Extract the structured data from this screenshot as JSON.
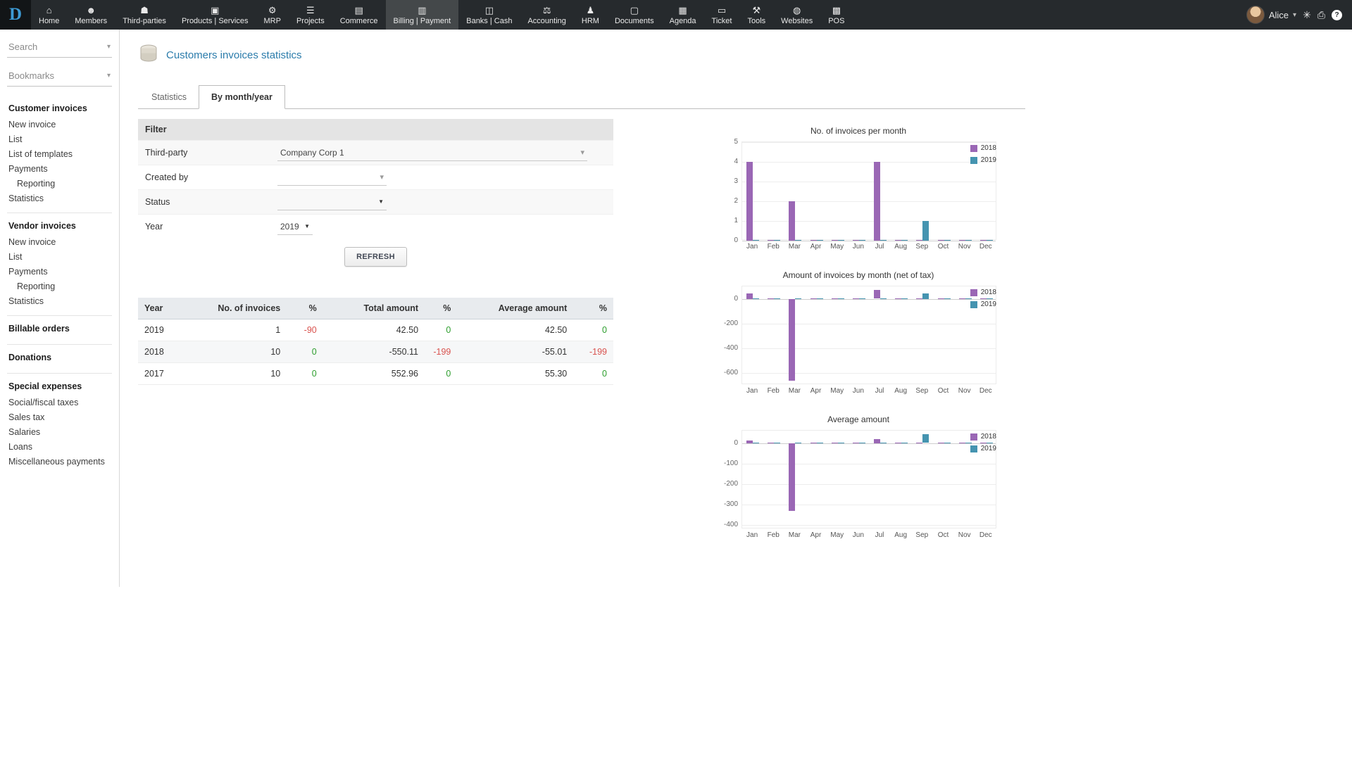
{
  "colors": {
    "positive": "#2e9e2e",
    "negative": "#d9534f",
    "accent": "#2b7cab"
  },
  "icons": {
    "chevron_down": "▾",
    "select_caret": "▼",
    "bug": "✳",
    "print": "⎙",
    "help": "?"
  },
  "topbar": {
    "logo": "D",
    "active_item": "Billing | Payment",
    "items": [
      {
        "label": "Home",
        "icon": "home-icon",
        "glyph": "⌂"
      },
      {
        "label": "Members",
        "icon": "members-icon",
        "glyph": "☻"
      },
      {
        "label": "Third-parties",
        "icon": "third-parties-icon",
        "glyph": "☗"
      },
      {
        "label": "Products | Services",
        "icon": "products-services-icon",
        "glyph": "▣"
      },
      {
        "label": "MRP",
        "icon": "mrp-icon",
        "glyph": "⚙"
      },
      {
        "label": "Projects",
        "icon": "projects-icon",
        "glyph": "☰"
      },
      {
        "label": "Commerce",
        "icon": "commerce-icon",
        "glyph": "▤"
      },
      {
        "label": "Billing | Payment",
        "icon": "billing-payment-icon",
        "glyph": "▥"
      },
      {
        "label": "Banks | Cash",
        "icon": "banks-cash-icon",
        "glyph": "◫"
      },
      {
        "label": "Accounting",
        "icon": "accounting-icon",
        "glyph": "⚖"
      },
      {
        "label": "HRM",
        "icon": "hrm-icon",
        "glyph": "♟"
      },
      {
        "label": "Documents",
        "icon": "documents-icon",
        "glyph": "▢"
      },
      {
        "label": "Agenda",
        "icon": "agenda-icon",
        "glyph": "▦"
      },
      {
        "label": "Ticket",
        "icon": "ticket-icon",
        "glyph": "▭"
      },
      {
        "label": "Tools",
        "icon": "tools-icon",
        "glyph": "⚒"
      },
      {
        "label": "Websites",
        "icon": "websites-icon",
        "glyph": "◍"
      },
      {
        "label": "POS",
        "icon": "pos-icon",
        "glyph": "▩"
      }
    ],
    "user": {
      "name": "Alice"
    }
  },
  "sidebar": {
    "search_label": "Search",
    "bookmarks_label": "Bookmarks",
    "sections": [
      {
        "title": "Customer invoices",
        "items": [
          {
            "label": "New invoice"
          },
          {
            "label": "List"
          },
          {
            "label": "List of templates"
          },
          {
            "label": "Payments"
          },
          {
            "label": "Reporting",
            "indent": true
          },
          {
            "label": "Statistics"
          }
        ]
      },
      {
        "title": "Vendor invoices",
        "items": [
          {
            "label": "New invoice"
          },
          {
            "label": "List"
          },
          {
            "label": "Payments"
          },
          {
            "label": "Reporting",
            "indent": true
          },
          {
            "label": "Statistics"
          }
        ]
      },
      {
        "title": "Billable orders",
        "items": []
      },
      {
        "title": "Donations",
        "items": []
      },
      {
        "title": "Special expenses",
        "items": [
          {
            "label": "Social/fiscal taxes"
          },
          {
            "label": "Sales tax"
          },
          {
            "label": "Salaries"
          },
          {
            "label": "Loans"
          },
          {
            "label": "Miscellaneous payments"
          }
        ]
      }
    ]
  },
  "page": {
    "title": "Customers invoices statistics"
  },
  "tabs": [
    {
      "label": "Statistics",
      "active": false
    },
    {
      "label": "By month/year",
      "active": true
    }
  ],
  "filter": {
    "header": "Filter",
    "third_party": {
      "label": "Third-party",
      "value": "Company Corp 1"
    },
    "created_by": {
      "label": "Created by",
      "value": ""
    },
    "status": {
      "label": "Status",
      "value": ""
    },
    "year": {
      "label": "Year",
      "value": "2019"
    },
    "refresh_label": "REFRESH"
  },
  "table": {
    "headers": [
      "Year",
      "No. of invoices",
      "%",
      "Total amount",
      "%",
      "Average amount",
      "%"
    ],
    "percent_columns": [
      2,
      4,
      6
    ],
    "rows": [
      {
        "cells": [
          "2019",
          "1",
          "-90",
          "42.50",
          "0",
          "42.50",
          "0"
        ]
      },
      {
        "cells": [
          "2018",
          "10",
          "0",
          "-550.11",
          "-199",
          "-55.01",
          "-199"
        ]
      },
      {
        "cells": [
          "2017",
          "10",
          "0",
          "552.96",
          "0",
          "55.30",
          "0"
        ]
      }
    ]
  },
  "chart_data": [
    {
      "type": "bar",
      "title": "No. of invoices per month",
      "categories": [
        "Jan",
        "Feb",
        "Mar",
        "Apr",
        "May",
        "Jun",
        "Jul",
        "Aug",
        "Sep",
        "Oct",
        "Nov",
        "Dec"
      ],
      "series": [
        {
          "name": "2018",
          "color": "#9a67b5",
          "values": [
            4,
            0,
            2,
            0,
            0,
            0,
            4,
            0,
            0,
            0,
            0,
            0
          ]
        },
        {
          "name": "2019",
          "color": "#4594b0",
          "values": [
            0,
            0,
            0,
            0,
            0,
            0,
            0,
            0,
            1,
            0,
            0,
            0
          ]
        }
      ],
      "ylim": [
        0,
        5
      ],
      "yticks": [
        0,
        1,
        2,
        3,
        4,
        5
      ],
      "legend": "top-right",
      "grid": true
    },
    {
      "type": "bar",
      "title": "Amount of invoices by month (net of tax)",
      "categories": [
        "Jan",
        "Feb",
        "Mar",
        "Apr",
        "May",
        "Jun",
        "Jul",
        "Aug",
        "Sep",
        "Oct",
        "Nov",
        "Dec"
      ],
      "series": [
        {
          "name": "2018",
          "color": "#9a67b5",
          "values": [
            45,
            0,
            -664,
            0,
            0,
            0,
            69,
            0,
            0,
            0,
            0,
            0
          ]
        },
        {
          "name": "2019",
          "color": "#4594b0",
          "values": [
            0,
            0,
            0,
            0,
            0,
            0,
            0,
            0,
            42.5,
            0,
            0,
            0
          ]
        }
      ],
      "ylim": [
        -700,
        100
      ],
      "yticks": [
        0,
        -200,
        -400,
        -600
      ],
      "legend": "top-right",
      "grid": true
    },
    {
      "type": "bar",
      "title": "Average amount",
      "categories": [
        "Jan",
        "Feb",
        "Mar",
        "Apr",
        "May",
        "Jun",
        "Jul",
        "Aug",
        "Sep",
        "Oct",
        "Nov",
        "Dec"
      ],
      "series": [
        {
          "name": "2018",
          "color": "#9a67b5",
          "values": [
            11.25,
            0,
            -332,
            0,
            0,
            0,
            17.25,
            0,
            0,
            0,
            0,
            0
          ]
        },
        {
          "name": "2019",
          "color": "#4594b0",
          "values": [
            0,
            0,
            0,
            0,
            0,
            0,
            0,
            0,
            42.5,
            0,
            0,
            0
          ]
        }
      ],
      "ylim": [
        -420,
        60
      ],
      "yticks": [
        0,
        -100,
        -200,
        -300,
        -400
      ],
      "legend": "top-right",
      "grid": true
    }
  ]
}
